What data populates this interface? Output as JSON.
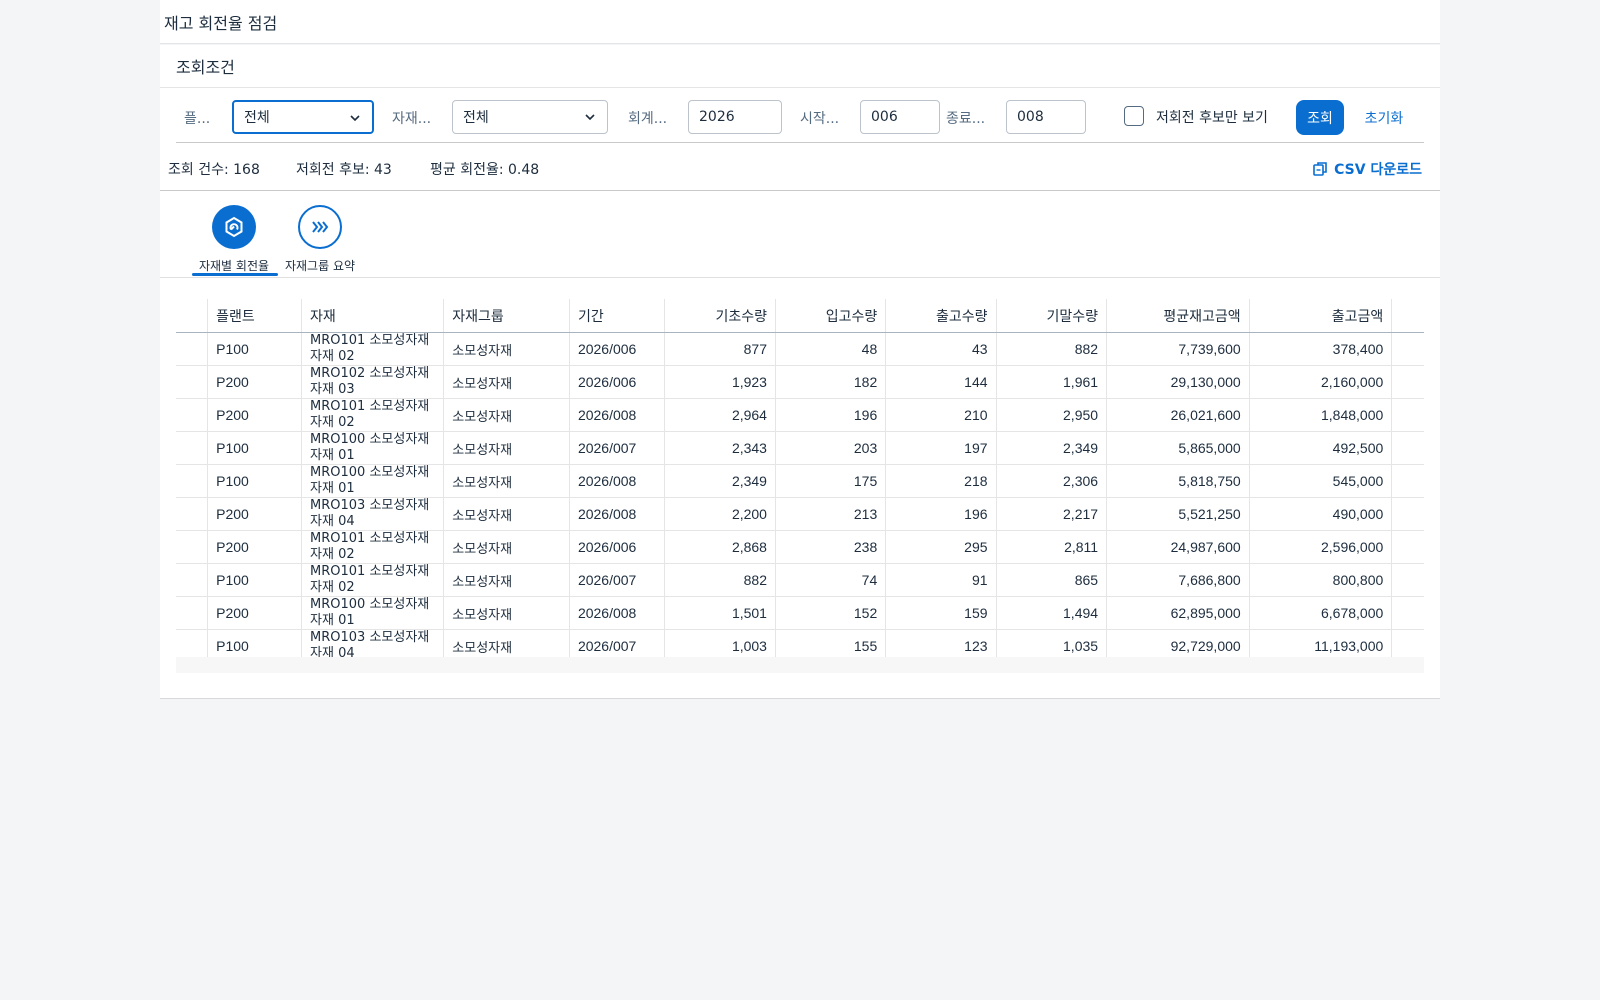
{
  "page": {
    "title": "재고 회전율 점검"
  },
  "filters": {
    "section_title": "조회조건",
    "plant_label": "플...",
    "plant_value": "전체",
    "matgroup_label": "자재...",
    "matgroup_value": "전체",
    "fiscal_label": "회계...",
    "fiscal_value": "2026",
    "start_label": "시작...",
    "start_value": "006",
    "end_label": "종료...",
    "end_value": "008",
    "checkbox_label": "저회전 후보만 보기",
    "search_label": "조회",
    "reset_label": "초기화"
  },
  "stats": {
    "count": "조회 건수: 168",
    "low": "저회전 후보: 43",
    "avg": "평균 회전율: 0.48",
    "csv": "CSV 다운로드"
  },
  "tabs": [
    {
      "label": "자재별 회전율",
      "icon": "material-turnover-icon",
      "active": true
    },
    {
      "label": "자재그룹 요약",
      "icon": "triple-chevron-right-icon",
      "active": false
    }
  ],
  "table": {
    "headers": [
      "플랜트",
      "자재",
      "자재그룹",
      "기간",
      "기초수량",
      "입고수량",
      "출고수량",
      "기말수량",
      "평균재고금액",
      "출고금액"
    ],
    "rows": [
      [
        "P100",
        "MRO101 소모성자재 자재 02",
        "소모성자재",
        "2026/006",
        "877",
        "48",
        "43",
        "882",
        "7,739,600",
        "378,400"
      ],
      [
        "P200",
        "MRO102 소모성자재 자재 03",
        "소모성자재",
        "2026/006",
        "1,923",
        "182",
        "144",
        "1,961",
        "29,130,000",
        "2,160,000"
      ],
      [
        "P200",
        "MRO101 소모성자재 자재 02",
        "소모성자재",
        "2026/008",
        "2,964",
        "196",
        "210",
        "2,950",
        "26,021,600",
        "1,848,000"
      ],
      [
        "P100",
        "MRO100 소모성자재 자재 01",
        "소모성자재",
        "2026/007",
        "2,343",
        "203",
        "197",
        "2,349",
        "5,865,000",
        "492,500"
      ],
      [
        "P100",
        "MRO100 소모성자재 자재 01",
        "소모성자재",
        "2026/008",
        "2,349",
        "175",
        "218",
        "2,306",
        "5,818,750",
        "545,000"
      ],
      [
        "P200",
        "MRO103 소모성자재 자재 04",
        "소모성자재",
        "2026/008",
        "2,200",
        "213",
        "196",
        "2,217",
        "5,521,250",
        "490,000"
      ],
      [
        "P200",
        "MRO101 소모성자재 자재 02",
        "소모성자재",
        "2026/006",
        "2,868",
        "238",
        "295",
        "2,811",
        "24,987,600",
        "2,596,000"
      ],
      [
        "P100",
        "MRO101 소모성자재 자재 02",
        "소모성자재",
        "2026/007",
        "882",
        "74",
        "91",
        "865",
        "7,686,800",
        "800,800"
      ],
      [
        "P200",
        "MRO100 소모성자재 자재 01",
        "소모성자재",
        "2026/008",
        "1,501",
        "152",
        "159",
        "1,494",
        "62,895,000",
        "6,678,000"
      ],
      [
        "P100",
        "MRO103 소모성자재 자재 04",
        "소모성자재",
        "2026/007",
        "1,003",
        "155",
        "123",
        "1,035",
        "92,729,000",
        "11,193,000"
      ]
    ]
  },
  "colors": {
    "accent": "#0a6ed1",
    "text": "#1d2d3e",
    "background": "#f4f5f7"
  }
}
